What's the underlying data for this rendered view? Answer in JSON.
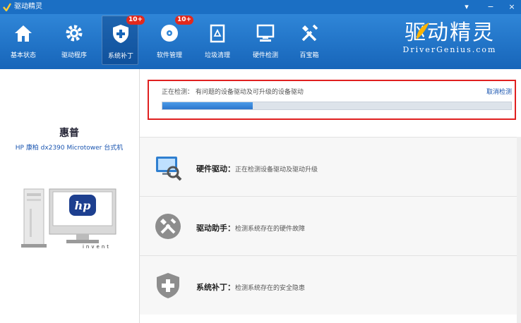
{
  "window": {
    "title": "驱动精灵",
    "menu_label": "▾",
    "minimize_label": "−",
    "close_label": "×"
  },
  "toolbar": {
    "items": [
      {
        "label": "基本状态",
        "icon": "home-icon"
      },
      {
        "label": "驱动程序",
        "icon": "gear-icon"
      },
      {
        "label": "系统补丁",
        "icon": "shield-icon",
        "badge": "10+"
      },
      {
        "label": "软件管理",
        "icon": "disc-icon",
        "badge": "10+"
      },
      {
        "label": "垃圾清理",
        "icon": "trash-icon"
      },
      {
        "label": "硬件检测",
        "icon": "monitor-icon"
      },
      {
        "label": "百宝箱",
        "icon": "tools-icon"
      }
    ],
    "active_index": 2
  },
  "logo": {
    "main": "驱动精灵",
    "sub": "DriverGenius.com"
  },
  "device": {
    "brand": "惠普",
    "model": "HP 康柏 dx2390 Microtower 台式机",
    "monitor_brand": "invent"
  },
  "scan": {
    "label": "正在检测： 有问题的设备驱动及可升级的设备驱动",
    "cancel_label": "取消检测",
    "progress": 0.26
  },
  "checks": [
    {
      "title": "硬件驱动：",
      "desc": "正在检测设备驱动及驱动升级",
      "icon": "hardware-search-icon"
    },
    {
      "title": "驱动助手：",
      "desc": "检测系统存在的硬件故障",
      "icon": "wrench-icon"
    },
    {
      "title": "系统补丁：",
      "desc": "检测系统存在的安全隐患",
      "icon": "shield-plus-icon"
    }
  ],
  "colors": {
    "accent": "#1b6fc4",
    "highlight": "#e02020",
    "progress": "#2d76cc"
  }
}
